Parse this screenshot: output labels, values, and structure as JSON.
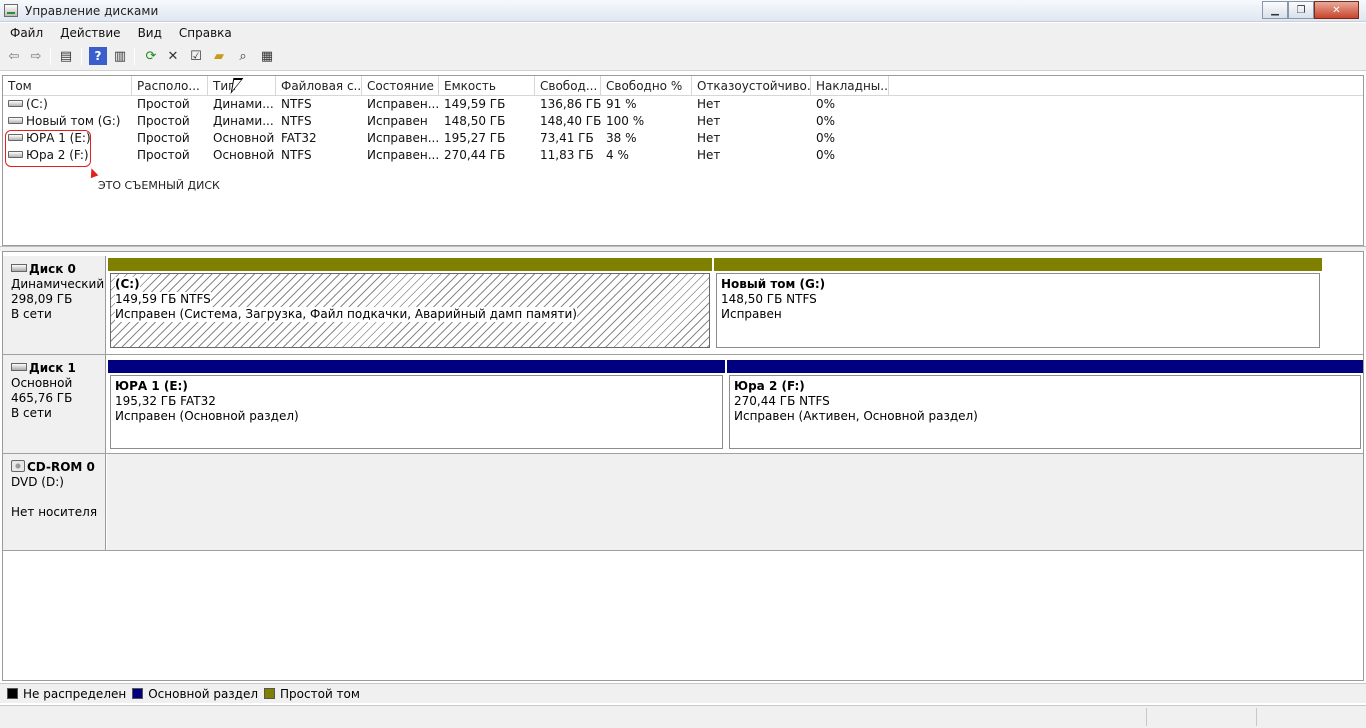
{
  "window": {
    "title": "Управление дисками"
  },
  "menu": [
    "Файл",
    "Действие",
    "Вид",
    "Справка"
  ],
  "toolbar": [
    {
      "name": "back-icon",
      "glyph": "⇦"
    },
    {
      "name": "forward-icon",
      "glyph": "⇨"
    },
    {
      "name": "show-hide-console-tree-icon",
      "glyph": "▤"
    },
    {
      "name": "help-icon",
      "glyph": "?"
    },
    {
      "name": "properties-view-icon",
      "glyph": "▥"
    },
    {
      "name": "refresh-icon",
      "glyph": "⟳"
    },
    {
      "name": "delete-icon",
      "glyph": "✕"
    },
    {
      "name": "properties-icon",
      "glyph": "☑"
    },
    {
      "name": "open-icon",
      "glyph": "📂"
    },
    {
      "name": "search-icon",
      "glyph": "🔍"
    },
    {
      "name": "export-icon",
      "glyph": "▦"
    }
  ],
  "volumes": {
    "columns": [
      "Том",
      "Располо...",
      "Тип",
      "Файловая с...",
      "Состояние",
      "Емкость",
      "Свобод...",
      "Свободно %",
      "Отказоустойчиво...",
      "Накладны..."
    ],
    "rows": [
      [
        "(C:)",
        "Простой",
        "Динами...",
        "NTFS",
        "Исправен...",
        "149,59 ГБ",
        "136,86 ГБ",
        "91 %",
        "Нет",
        "0%"
      ],
      [
        "Новый том (G:)",
        "Простой",
        "Динами...",
        "NTFS",
        "Исправен",
        "148,50 ГБ",
        "148,40 ГБ",
        "100 %",
        "Нет",
        "0%"
      ],
      [
        "ЮРА 1 (E:)",
        "Простой",
        "Основной",
        "FAT32",
        "Исправен...",
        "195,27 ГБ",
        "73,41 ГБ",
        "38 %",
        "Нет",
        "0%"
      ],
      [
        "Юра 2 (F:)",
        "Простой",
        "Основной",
        "NTFS",
        "Исправен...",
        "270,44 ГБ",
        "11,83 ГБ",
        "4 %",
        "Нет",
        "0%"
      ]
    ],
    "annotation": "ЭТО СЪЕМНЫЙ ДИСК"
  },
  "disks": [
    {
      "name": "Диск 0",
      "lines": [
        "Динамический",
        "298,09 ГБ",
        "В сети"
      ],
      "partitions": [
        {
          "title": "(C:)",
          "size": "149,59 ГБ NTFS",
          "status": "Исправен (Система, Загрузка, Файл подкачки, Аварийный дамп памяти)"
        },
        {
          "title": "Новый том  (G:)",
          "size": "148,50 ГБ NTFS",
          "status": "Исправен"
        }
      ]
    },
    {
      "name": "Диск 1",
      "lines": [
        "Основной",
        "465,76 ГБ",
        "В сети"
      ],
      "partitions": [
        {
          "title": "ЮРА 1  (E:)",
          "size": "195,32 ГБ FAT32",
          "status": "Исправен (Основной раздел)"
        },
        {
          "title": "Юра 2  (F:)",
          "size": "270,44 ГБ NTFS",
          "status": "Исправен (Активен, Основной раздел)"
        }
      ]
    },
    {
      "name": "CD-ROM 0",
      "lines": [
        "DVD (D:)",
        "",
        "Нет носителя"
      ],
      "partitions": []
    }
  ],
  "legend": [
    {
      "label": "Не распределен",
      "color": "#000000"
    },
    {
      "label": "Основной раздел",
      "color": "#00007f"
    },
    {
      "label": "Простой том",
      "color": "#7f7f00"
    }
  ],
  "colors": {
    "simple": "#808000",
    "primary": "#000080"
  }
}
